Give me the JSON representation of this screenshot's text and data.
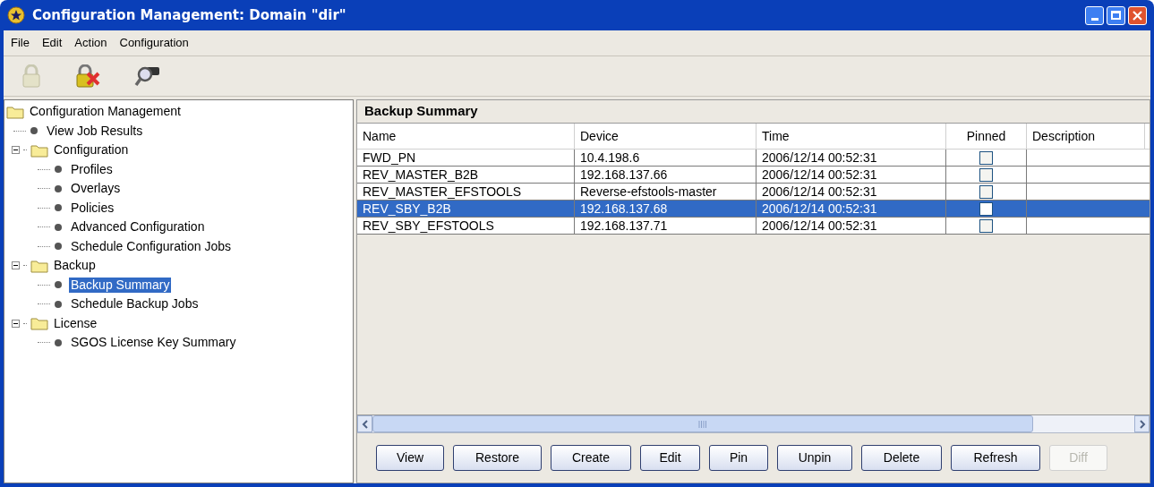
{
  "window": {
    "title": "Configuration Management: Domain \"dir\""
  },
  "menu": [
    {
      "label": "File"
    },
    {
      "label": "Edit"
    },
    {
      "label": "Action"
    },
    {
      "label": "Configuration"
    }
  ],
  "toolbar": [
    {
      "kind": "lock",
      "disabled": true
    },
    {
      "kind": "unlock",
      "disabled": false
    },
    {
      "kind": "search",
      "disabled": false
    }
  ],
  "tree": [
    {
      "label": "Configuration Management",
      "kind": "folder",
      "selected": false,
      "children": [
        {
          "label": "View Job Results",
          "kind": "leaf",
          "selected": false
        },
        {
          "label": "Configuration",
          "kind": "folder",
          "expanded": true,
          "selected": false,
          "children": [
            {
              "label": "Profiles",
              "kind": "leaf",
              "selected": false
            },
            {
              "label": "Overlays",
              "kind": "leaf",
              "selected": false
            },
            {
              "label": "Policies",
              "kind": "leaf",
              "selected": false
            },
            {
              "label": "Advanced Configuration",
              "kind": "leaf",
              "selected": false
            },
            {
              "label": "Schedule Configuration Jobs",
              "kind": "leaf",
              "selected": false
            }
          ]
        },
        {
          "label": "Backup",
          "kind": "folder",
          "expanded": true,
          "selected": false,
          "children": [
            {
              "label": "Backup Summary",
              "kind": "leaf",
              "selected": true
            },
            {
              "label": "Schedule Backup Jobs",
              "kind": "leaf",
              "selected": false
            }
          ]
        },
        {
          "label": "License",
          "kind": "folder",
          "expanded": true,
          "selected": false,
          "children": [
            {
              "label": "SGOS License Key Summary",
              "kind": "leaf",
              "selected": false
            }
          ]
        }
      ]
    }
  ],
  "panel": {
    "title": "Backup Summary"
  },
  "table": {
    "columns": [
      "Name",
      "Device",
      "Time",
      "Pinned",
      "Description"
    ],
    "rows": [
      {
        "name": "FWD_PN",
        "device": "10.4.198.6",
        "time": "2006/12/14 00:52:31",
        "pinned": false,
        "selected": false
      },
      {
        "name": "REV_MASTER_B2B",
        "device": "192.168.137.66",
        "time": "2006/12/14 00:52:31",
        "pinned": false,
        "selected": false
      },
      {
        "name": "REV_MASTER_EFSTOOLS",
        "device": "Reverse-efstools-master",
        "time": "2006/12/14 00:52:31",
        "pinned": false,
        "selected": false
      },
      {
        "name": "REV_SBY_B2B",
        "device": "192.168.137.68",
        "time": "2006/12/14 00:52:31",
        "pinned": false,
        "selected": true
      },
      {
        "name": "REV_SBY_EFSTOOLS",
        "device": "192.168.137.71",
        "time": "2006/12/14 00:52:31",
        "pinned": false,
        "selected": false
      }
    ]
  },
  "buttons": [
    {
      "label": "View",
      "disabled": false
    },
    {
      "label": "Restore",
      "disabled": false
    },
    {
      "label": "Create",
      "disabled": false
    },
    {
      "label": "Edit",
      "disabled": false
    },
    {
      "label": "Pin",
      "disabled": false
    },
    {
      "label": "Unpin",
      "disabled": false
    },
    {
      "label": "Delete",
      "disabled": false
    },
    {
      "label": "Refresh",
      "disabled": false
    },
    {
      "label": "Diff",
      "disabled": true
    }
  ]
}
